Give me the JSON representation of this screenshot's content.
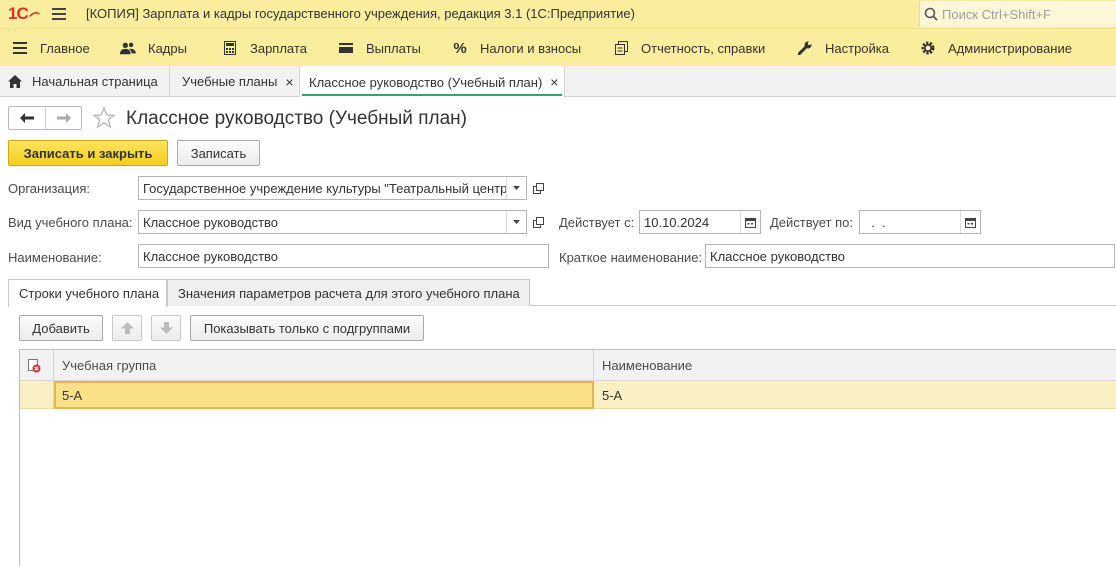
{
  "titlebar": {
    "logo": "1С",
    "title": "[КОПИЯ] Зарплата и кадры государственного учреждения, редакция 3.1  (1С:Предприятие)",
    "search_placeholder": "Поиск Ctrl+Shift+F"
  },
  "menu": {
    "items": [
      {
        "label": "Главное",
        "icon": "hamburger-icon"
      },
      {
        "label": "Кадры",
        "icon": "people-icon"
      },
      {
        "label": "Зарплата",
        "icon": "calculator-icon"
      },
      {
        "label": "Выплаты",
        "icon": "wallet-icon"
      },
      {
        "label": "Налоги и взносы",
        "icon": "percent-icon"
      },
      {
        "label": "Отчетность, справки",
        "icon": "documents-icon"
      },
      {
        "label": "Настройка",
        "icon": "wrench-icon"
      },
      {
        "label": "Администрирование",
        "icon": "gear-icon"
      }
    ]
  },
  "tabs": [
    {
      "label": "Начальная страница",
      "icon": "home-icon"
    },
    {
      "label": "Учебные планы",
      "close": "×"
    },
    {
      "label": "Классное руководство (Учебный план)",
      "close": "×"
    }
  ],
  "form": {
    "title": "Классное руководство (Учебный план)",
    "save_close_label": "Записать и закрыть",
    "save_label": "Записать",
    "organization_label": "Организация:",
    "organization_value": "Государственное учреждение культуры \"Театральный центр",
    "plan_type_label": "Вид учебного плана:",
    "plan_type_value": "Классное руководство",
    "valid_from_label": "Действует с:",
    "valid_from_value": "10.10.2024",
    "valid_to_label": "Действует по:",
    "valid_to_value": "  .  .",
    "name_label": "Наименование:",
    "name_value": "Классное руководство",
    "short_name_label": "Краткое наименование:",
    "short_name_value": "Классное руководство"
  },
  "form_tabs": [
    {
      "label": "Строки учебного плана"
    },
    {
      "label": "Значения параметров расчета для этого учебного плана"
    }
  ],
  "table_toolbar": {
    "add_label": "Добавить",
    "subgroups_label": "Показывать только с подгруппами"
  },
  "grid": {
    "columns": [
      "Учебная группа",
      "Наименование"
    ],
    "rows": [
      {
        "group": "5-А",
        "name": "5-А"
      }
    ]
  },
  "colors": {
    "header_bg": "#fbed9e",
    "primary_button": "#f5cf1d",
    "selected_row": "#fbf0c3",
    "active_tab_accent": "#3aa35f"
  }
}
